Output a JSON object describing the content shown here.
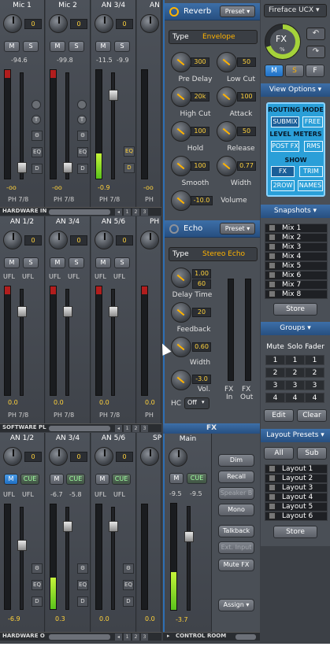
{
  "hardware_inputs": {
    "bar_label": "HARDWARE IN",
    "page_numbers": [
      "1",
      "2",
      "3"
    ],
    "channels": [
      {
        "name": "Mic 1",
        "gain": "0",
        "peak": "-94.6",
        "bottom": "-oo",
        "ph": "PH 7/8"
      },
      {
        "name": "Mic 2",
        "gain": "0",
        "peak": "-99.8",
        "bottom": "-oo",
        "ph": "PH 7/8"
      },
      {
        "name": "AN 3/4",
        "gain": "0",
        "peak_l": "-11.5",
        "peak_r": "-9.9",
        "bottom": "-0.9",
        "ph": "PH 7/8",
        "eq": "EQ",
        "d": "D"
      },
      {
        "name": "AN",
        "gain": "0",
        "bottom": "-oo",
        "ph": "PH"
      }
    ]
  },
  "software_playback": {
    "bar_label": "SOFTWARE PL",
    "page_numbers": [
      "1",
      "2",
      "3"
    ],
    "channels": [
      {
        "name": "AN 1/2",
        "gain": "0",
        "ufl_l": "UFL",
        "ufl_r": "UFL",
        "bottom": "0.0",
        "ph": "PH 7/8"
      },
      {
        "name": "AN 3/4",
        "gain": "0",
        "ufl_l": "UFL",
        "ufl_r": "UFL",
        "bottom": "0.0",
        "ph": "PH 7/8"
      },
      {
        "name": "AN 5/6",
        "gain": "0",
        "ufl_l": "UFL",
        "ufl_r": "UFL",
        "bottom": "0.0",
        "ph": "PH 7/8"
      },
      {
        "name": "PH",
        "gain": "0",
        "bottom": "0.0",
        "ph": "PH"
      }
    ]
  },
  "hardware_outputs": {
    "bar_label": "HARDWARE O",
    "page_numbers": [
      "1",
      "2",
      "3"
    ],
    "channels": [
      {
        "name": "AN 1/2",
        "gain": "0",
        "ufl_l": "UFL",
        "ufl_r": "UFL",
        "bottom": "-6.9",
        "cue": "CUE",
        "m": "M"
      },
      {
        "name": "AN 3/4",
        "gain": "0",
        "peak_l": "-6.7",
        "peak_r": "-5.8",
        "bottom": "0.3",
        "cue": "CUE",
        "m": "M"
      },
      {
        "name": "AN 5/6",
        "gain": "0",
        "ufl_l": "UFL",
        "ufl_r": "UFL",
        "bottom": "0.0",
        "cue": "CUE",
        "m": "M"
      },
      {
        "name": "SP",
        "gain": "0",
        "bottom": "0.0"
      }
    ]
  },
  "labels": {
    "m": "M",
    "s": "S",
    "t": "T",
    "eq": "EQ",
    "d": "D"
  },
  "reverb": {
    "title": "Reverb",
    "preset": "Preset",
    "type_label": "Type",
    "type_value": "Envelope",
    "params": [
      {
        "label": "Pre Delay",
        "value": "300"
      },
      {
        "label": "Low Cut",
        "value": "50"
      },
      {
        "label": "High Cut",
        "value": "20k"
      },
      {
        "label": "Attack",
        "value": "100"
      },
      {
        "label": "Hold",
        "value": "100"
      },
      {
        "label": "Release",
        "value": "50"
      },
      {
        "label": "Smooth",
        "value": "100"
      },
      {
        "label": "Width",
        "value": "0.77"
      },
      {
        "label": "Volume",
        "value": "-10.0"
      }
    ]
  },
  "echo": {
    "title": "Echo",
    "preset": "Preset",
    "type_label": "Type",
    "type_value": "Stereo Echo",
    "delay_time_value": "1.00",
    "delay_time_sub": "60",
    "delay_time_label": "Delay Time",
    "feedback_value": "20",
    "feedback_label": "Feedback",
    "width_value": "0.60",
    "width_label": "Width",
    "vol_value": "-3.0",
    "vol_label": "Vol.",
    "hc_label": "HC",
    "hc_value": "Off",
    "fx_in": "FX\nIn",
    "fx_out": "FX\nOut",
    "fx_in_a": "FX",
    "fx_in_b": "In",
    "fx_out_a": "FX",
    "fx_out_b": "Out"
  },
  "fx_header": "FX",
  "control_room": {
    "bar_label": "CONTROL ROOM",
    "main_label": "Main",
    "m": "M",
    "cue": "CUE",
    "peak_l": "-9.5",
    "peak_r": "-9.5",
    "bottom": "-3.7",
    "buttons": [
      "Dim",
      "Recall",
      "Speaker B",
      "Mono",
      "Talkback",
      "Ext. Input",
      "Mute FX",
      "Assign"
    ]
  },
  "device": {
    "title": "Fireface UCX",
    "knob_label": "FX",
    "knob_unit": "%",
    "msf": [
      "M",
      "S",
      "F"
    ]
  },
  "view_options": {
    "title": "View Options",
    "routing_mode": "ROUTING MODE",
    "submix": "SUBMIX",
    "free": "FREE",
    "level_meters": "LEVEL METERS",
    "postfx": "POST FX",
    "rms": "RMS",
    "show": "SHOW",
    "fx": "FX",
    "trim": "TRIM",
    "row2": "2ROW",
    "names": "NAMES"
  },
  "snapshots": {
    "title": "Snapshots",
    "items": [
      "Mix 1",
      "Mix 2",
      "Mix 3",
      "Mix 4",
      "Mix 5",
      "Mix 6",
      "Mix 7",
      "Mix 8"
    ],
    "store": "Store"
  },
  "groups": {
    "title": "Groups",
    "headers": [
      "Mute",
      "Solo",
      "Fader"
    ],
    "rows": [
      [
        "1",
        "1",
        "1"
      ],
      [
        "2",
        "2",
        "2"
      ],
      [
        "3",
        "3",
        "3"
      ],
      [
        "4",
        "4",
        "4"
      ]
    ],
    "edit": "Edit",
    "clear": "Clear"
  },
  "layout_presets": {
    "title": "Layout Presets",
    "all": "All",
    "sub": "Sub",
    "items": [
      "Layout 1",
      "Layout 2",
      "Layout 3",
      "Layout 4",
      "Layout 5",
      "Layout 6"
    ],
    "store": "Store"
  }
}
